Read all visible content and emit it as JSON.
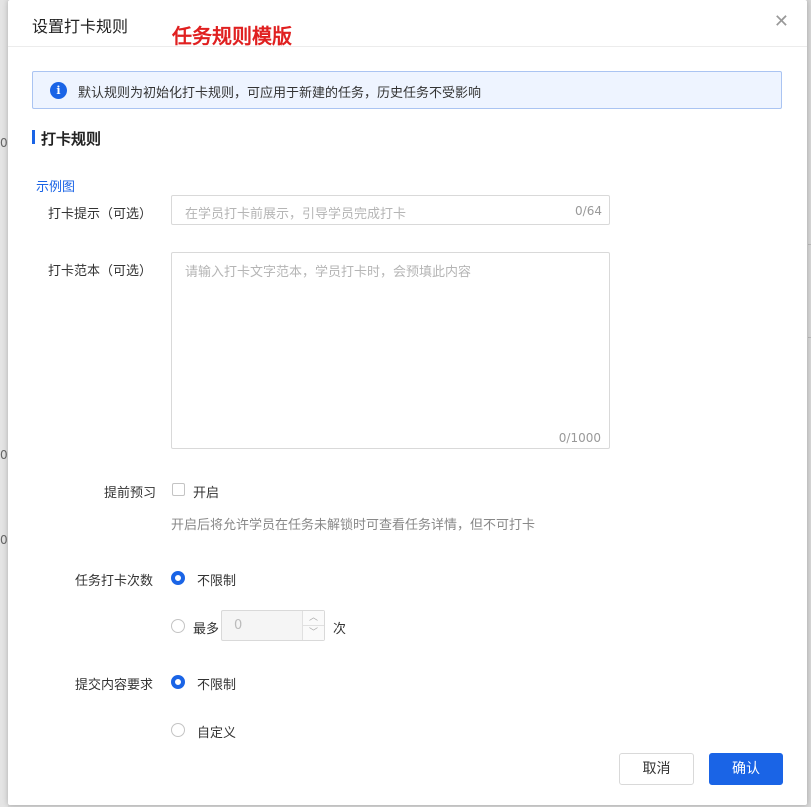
{
  "annotation": "任务规则模版",
  "modal": {
    "title": "设置打卡规则",
    "close_icon": "close-icon"
  },
  "notice": {
    "icon": "info-icon",
    "text": "默认规则为初始化打卡规则，可应用于新建的任务，历史任务不受影响"
  },
  "section": {
    "title": "打卡规则",
    "example_link": "示例图"
  },
  "form": {
    "tip": {
      "label": "打卡提示（可选）",
      "placeholder": "在学员打卡前展示，引导学员完成打卡",
      "counter": "0/64"
    },
    "template": {
      "label": "打卡范本（可选）",
      "placeholder": "请输入打卡文字范本，学员打卡时，会预填此内容",
      "counter": "0/1000"
    },
    "preview": {
      "label": "提前预习",
      "checkbox_label": "开启",
      "help": "开启后将允许学员在任务未解锁时可查看任务详情，但不可打卡"
    },
    "checkin_times": {
      "label": "任务打卡次数",
      "option_unlimited": "不限制",
      "option_max_prefix": "最多",
      "max_value": "0",
      "option_max_suffix": "次"
    },
    "content_req": {
      "label": "提交内容要求",
      "option_unlimited": "不限制",
      "option_custom": "自定义"
    }
  },
  "footer": {
    "cancel": "取消",
    "confirm": "确认"
  },
  "colors": {
    "primary": "#1a64e6",
    "annotation": "#e02020"
  }
}
